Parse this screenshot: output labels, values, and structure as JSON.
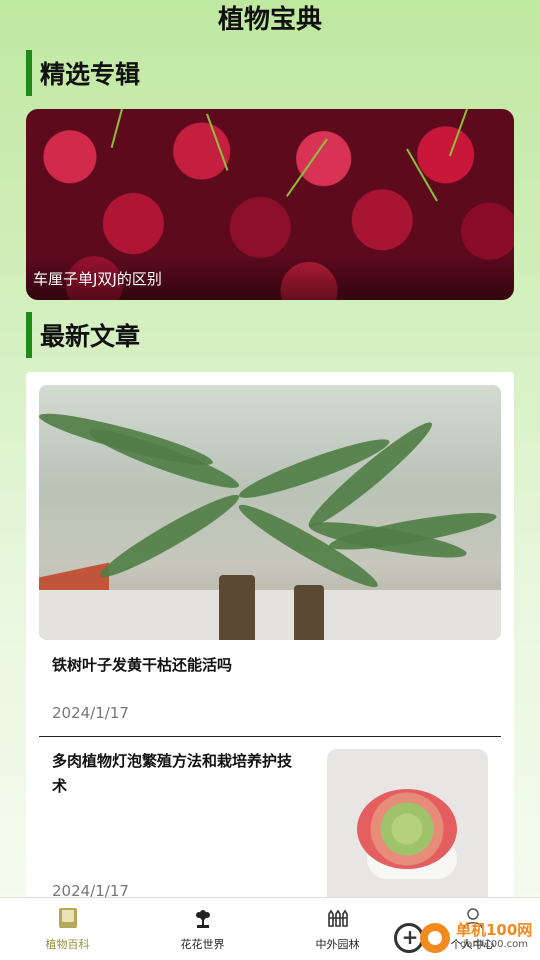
{
  "app": {
    "title": "植物宝典"
  },
  "featured": {
    "section_title": "精选专辑",
    "card_caption": "车厘子单J双J的区别"
  },
  "latest": {
    "section_title": "最新文章",
    "articles": [
      {
        "title": "铁树叶子发黄干枯还能活吗",
        "date": "2024/1/17"
      },
      {
        "title": "多肉植物灯泡繁殖方法和栽培养护技术",
        "date": "2024/1/17"
      }
    ]
  },
  "nav": {
    "active_color": "#9c8f3c",
    "items": [
      {
        "label": "植物百科",
        "icon": "book-icon"
      },
      {
        "label": "花花世界",
        "icon": "flower-icon"
      },
      {
        "label": "中外园林",
        "icon": "fence-icon"
      },
      {
        "label": "个人中心",
        "icon": "person-icon"
      }
    ]
  },
  "watermark": {
    "site_cn": "单机100网",
    "site_url": "danji100.com"
  },
  "colors": {
    "accent": "#1f8a17",
    "background": "#d3efbd"
  }
}
